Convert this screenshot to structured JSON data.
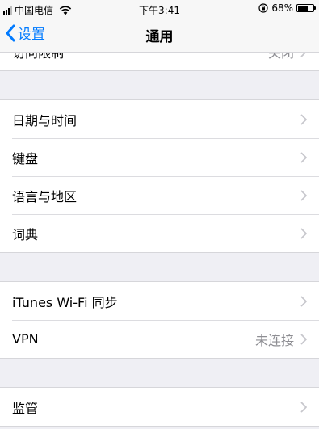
{
  "status_bar": {
    "carrier": "中国电信",
    "time": "下午3:41",
    "battery_percent": "68%",
    "battery_level": 0.68
  },
  "nav": {
    "back_label": "设置",
    "title": "通用"
  },
  "groups": [
    {
      "rows": [
        {
          "label": "访问限制",
          "value": "关闭"
        }
      ]
    },
    {
      "rows": [
        {
          "label": "日期与时间",
          "value": ""
        },
        {
          "label": "键盘",
          "value": ""
        },
        {
          "label": "语言与地区",
          "value": ""
        },
        {
          "label": "词典",
          "value": ""
        }
      ]
    },
    {
      "rows": [
        {
          "label": "iTunes Wi-Fi 同步",
          "value": ""
        },
        {
          "label": "VPN",
          "value": "未连接"
        }
      ]
    },
    {
      "rows": [
        {
          "label": "监管",
          "value": ""
        }
      ]
    }
  ],
  "colors": {
    "accent": "#007aff",
    "background": "#efeff4",
    "secondary_text": "#8e8e93",
    "chevron": "#c7c7cc"
  }
}
